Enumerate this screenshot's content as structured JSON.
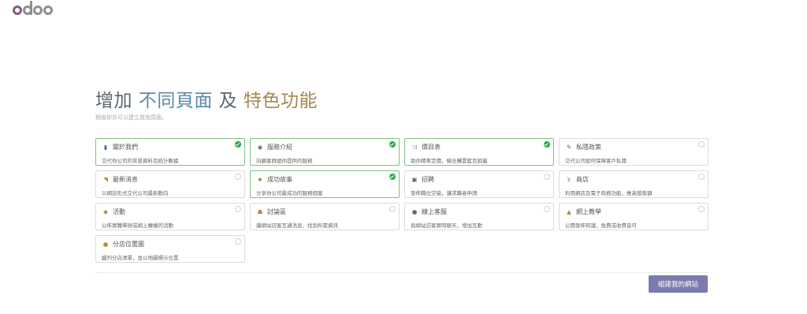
{
  "logo": {
    "text": "odoo"
  },
  "headline": {
    "part1": "增加",
    "part2": "不同頁面",
    "part3": "及",
    "part4": "特色功能"
  },
  "subtitle": "稍後你亦可以建立其他頁面。",
  "features": [
    {
      "title": "關於我們",
      "desc": "交代你公司的背景資料及統計數據",
      "icon": "document-icon",
      "glyph": "▮",
      "icon_color": "#3b6ea8",
      "selected": true
    },
    {
      "title": "服務介紹",
      "desc": "向顧客群組你提供的服務",
      "icon": "eye-icon",
      "glyph": "◉",
      "icon_color": "#5b6671",
      "selected": true
    },
    {
      "title": "價目表",
      "desc": "助你精準定價，僱合購置籃及銷量",
      "icon": "shuffle-icon",
      "glyph": "⤨",
      "icon_color": "#3b6ea8",
      "selected": true
    },
    {
      "title": "私隱政策",
      "desc": "交代公司如何保障客戶私隱",
      "icon": "gavel-icon",
      "glyph": "✎",
      "icon_color": "#3b6ea8",
      "selected": false
    },
    {
      "title": "最新消息",
      "desc": "以網誌形式交代公司最新動向",
      "icon": "rss-icon",
      "glyph": "◥",
      "icon_color": "#c8842e",
      "selected": false
    },
    {
      "title": "成功故事",
      "desc": "分享你公司最成功的服務個案",
      "icon": "star-icon",
      "glyph": "★",
      "icon_color": "#8a6a1c",
      "selected": true
    },
    {
      "title": "招聘",
      "desc": "發佈職位空缺，讓求職者申請",
      "icon": "id-card-icon",
      "glyph": "▣",
      "icon_color": "#5b6671",
      "selected": false
    },
    {
      "title": "商店",
      "desc": "利用網店及電子商務功能，推高銷售額",
      "icon": "cart-icon",
      "glyph": "⊻",
      "icon_color": "#c8842e",
      "selected": false
    },
    {
      "title": "活動",
      "desc": "公佈實體舉辦或網上轉播的活動",
      "icon": "ticket-icon",
      "glyph": "◆",
      "icon_color": "#b8893a",
      "selected": false
    },
    {
      "title": "討論區",
      "desc": "讓網站訪客互通消息，找到所需資訊",
      "icon": "users-icon",
      "glyph": "☗",
      "icon_color": "#b8893a",
      "selected": false
    },
    {
      "title": "線上客服",
      "desc": "與網站訪客實時聊天，增加互動",
      "icon": "chat-icon",
      "glyph": "●",
      "icon_color": "#5b6671",
      "selected": false
    },
    {
      "title": "網上教學",
      "desc": "公開發佈知識，免費或收費皆可",
      "icon": "graduation-cap-icon",
      "glyph": "▲",
      "icon_color": "#b8893a",
      "selected": false
    },
    {
      "title": "分店位置圖",
      "desc": "臚列分店清單，並以地圖標示位置",
      "icon": "map-marker-icon",
      "glyph": "●",
      "icon_color": "#c8842e",
      "selected": false
    }
  ],
  "build_button": "組建我的網站"
}
